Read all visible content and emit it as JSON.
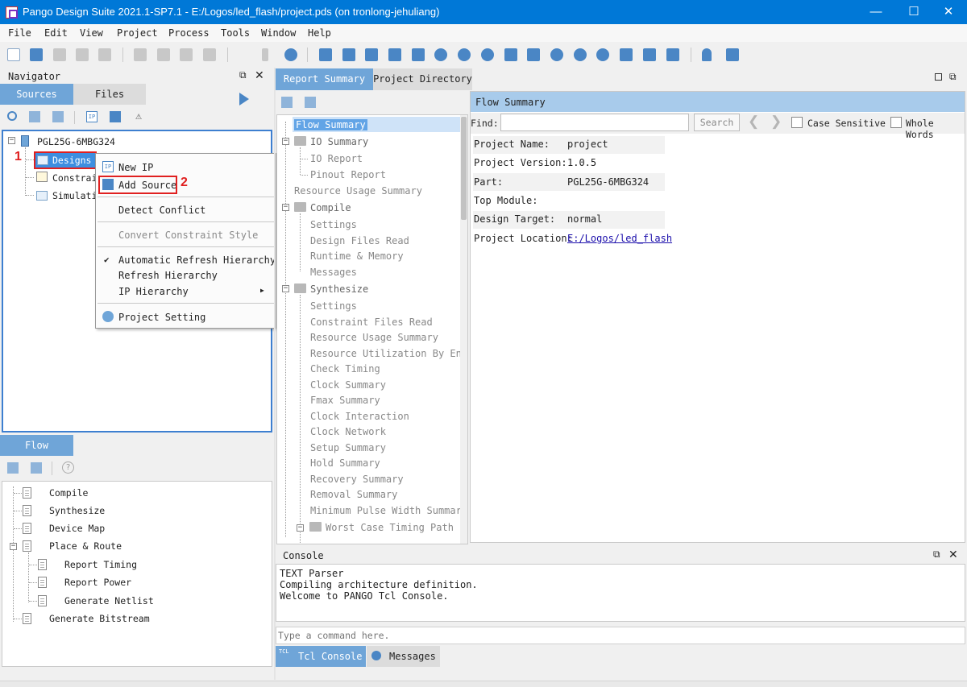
{
  "window": {
    "title": "Pango Design Suite 2021.1-SP7.1 - E:/Logos/led_flash/project.pds (on tronlong-jehuliang)",
    "minimize": "—",
    "maximize": "☐",
    "close": "✕"
  },
  "menu": [
    "File",
    "Edit",
    "View",
    "Project",
    "Process",
    "Tools",
    "Window",
    "Help"
  ],
  "navigator": {
    "title": "Navigator",
    "tabs": {
      "sources": "Sources",
      "files": "Files"
    },
    "tree": {
      "root": "PGL25G-6MBG324",
      "designs": "Designs",
      "constraints": "Constrai",
      "simulation": "Simulatio"
    }
  },
  "annotations": {
    "one": "1",
    "two": "2"
  },
  "context_menu": {
    "new_ip": "New IP",
    "add_source": "Add Source",
    "detect_conflict": "Detect Conflict",
    "convert_constraint_style": "Convert Constraint Style",
    "auto_refresh": "Automatic Refresh Hierarchy",
    "refresh": "Refresh Hierarchy",
    "ip_hierarchy": "IP Hierarchy",
    "project_setting": "Project Setting",
    "checkmark": "✔",
    "submenu_arrow": "▶"
  },
  "flow": {
    "tab": "Flow",
    "help": "?",
    "items": {
      "compile": "Compile",
      "synthesize": "Synthesize",
      "device_map": "Device Map",
      "place_route": "Place & Route",
      "report_timing": "Report Timing",
      "report_power": "Report Power",
      "generate_netlist": "Generate Netlist",
      "generate_bitstream": "Generate Bitstream"
    }
  },
  "report": {
    "tabs": {
      "summary": "Report Summary",
      "directory": "Project Directory"
    },
    "tree": [
      "Flow Summary",
      "IO Summary",
      "IO Report",
      "Pinout Report",
      "Resource Usage Summary",
      "Compile",
      "Settings",
      "Design Files Read",
      "Runtime & Memory",
      "Messages",
      "Synthesize",
      "Settings",
      "Constraint Files Read",
      "Resource Usage Summary",
      "Resource Utilization By Ent…",
      "Check Timing",
      "Clock Summary",
      "Fmax Summary",
      "Clock Interaction",
      "Clock Network",
      "Setup Summary",
      "Hold Summary",
      "Recovery Summary",
      "Removal Summary",
      "Minimum Pulse Width Summary",
      "Worst Case Timing Path"
    ],
    "detail_title": "Flow Summary",
    "find_label": "Find:",
    "find_value": "",
    "search_button": "Search",
    "case_sensitive": "Case Sensitive",
    "whole_words": "Whole Words",
    "prev": "❮",
    "next": "❯",
    "fields": {
      "project_name_label": "Project Name:",
      "project_name": "project",
      "project_version_label": "Project Version:",
      "project_version": "1.0.5",
      "part_label": "Part:",
      "part": "PGL25G-6MBG324",
      "top_module_label": "Top Module:",
      "top_module": "",
      "design_target_label": "Design Target:",
      "design_target": "normal",
      "project_location_label": "Project Location:",
      "project_location": "E:/Logos/led_flash"
    }
  },
  "console": {
    "title": "Console",
    "lines": [
      "TEXT Parser",
      "Compiling architecture definition.",
      "Welcome to PANGO Tcl Console."
    ],
    "input_placeholder": "Type a command here.",
    "tabs": {
      "tcl": "Tcl Console",
      "messages": "Messages"
    },
    "tcl_badge": "TCL"
  },
  "colors": {
    "titlebar": "#0078d7",
    "active_tab": "#6fa5d8",
    "selection": "#3d8ee0",
    "highlight_box": "#e02020",
    "panel_border": "#3d7fd0"
  }
}
